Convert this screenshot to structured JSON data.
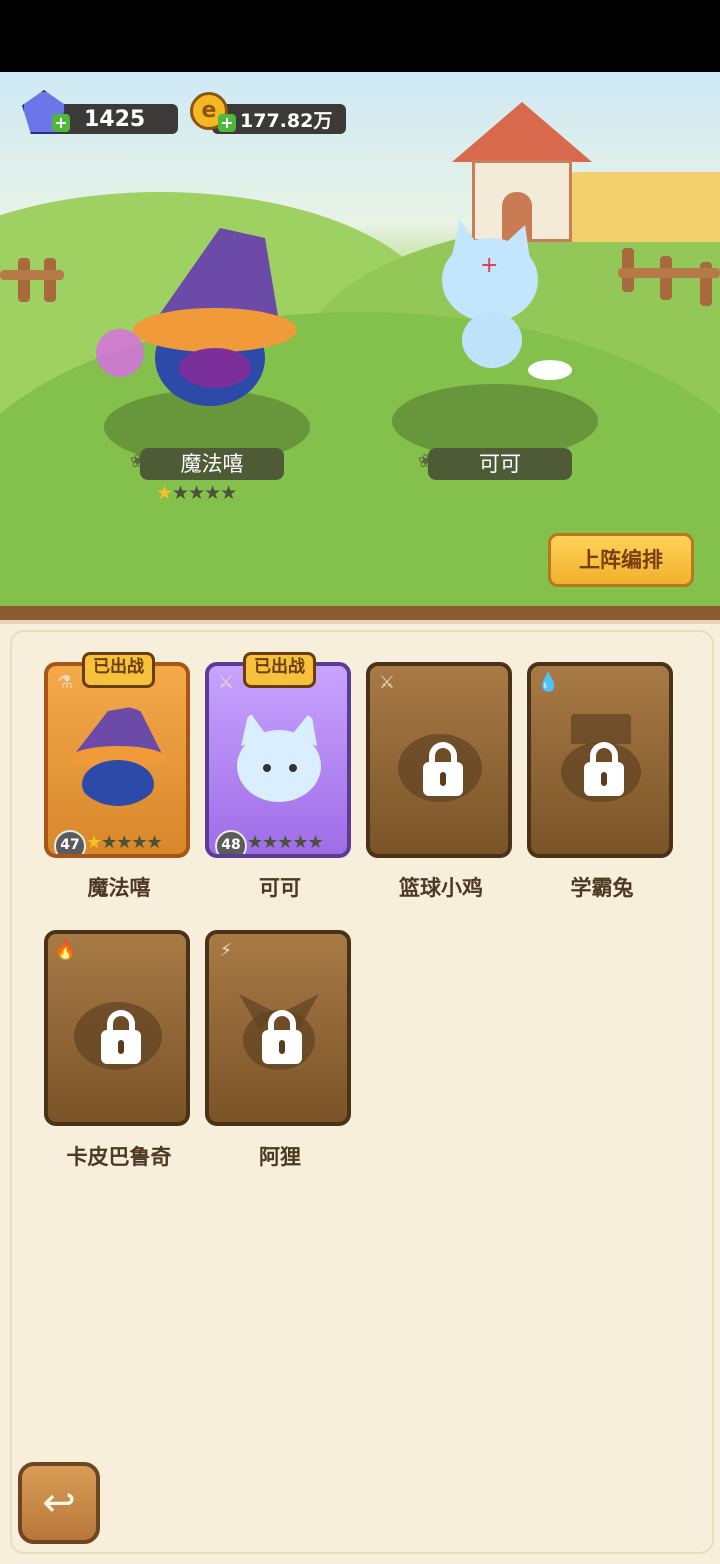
{
  "currency": {
    "gems": "1425",
    "coins": "177.82万"
  },
  "team": [
    {
      "name": "魔法嘻",
      "stars_filled": 1,
      "stars_total": 5
    },
    {
      "name": "可可"
    }
  ],
  "lineup_button": "上阵编排",
  "roster": [
    {
      "name": "魔法嘻",
      "status": "已出战",
      "level": "47",
      "stars_filled": 1,
      "stars_total": 5,
      "locked": false,
      "type_icon": "potion-icon",
      "frame": "orange"
    },
    {
      "name": "可可",
      "status": "已出战",
      "level": "48",
      "stars_filled": 0,
      "stars_total": 5,
      "locked": false,
      "type_icon": "sword-icon",
      "frame": "purple"
    },
    {
      "name": "篮球小鸡",
      "locked": true,
      "type_icon": "sword-icon"
    },
    {
      "name": "学霸兔",
      "locked": true,
      "type_icon": "water-drop-icon"
    },
    {
      "name": "卡皮巴鲁奇",
      "locked": true,
      "type_icon": "fire-icon"
    },
    {
      "name": "阿狸",
      "locked": true,
      "type_icon": "lightning-icon"
    }
  ],
  "back_button": "back-arrow-icon",
  "colors": {
    "accent_button": "#f1b12d",
    "panel_bg": "#f7efdc",
    "frame_orange": "#d9872b",
    "frame_purple": "#9e6de6",
    "locked_card": "#7a5428"
  }
}
